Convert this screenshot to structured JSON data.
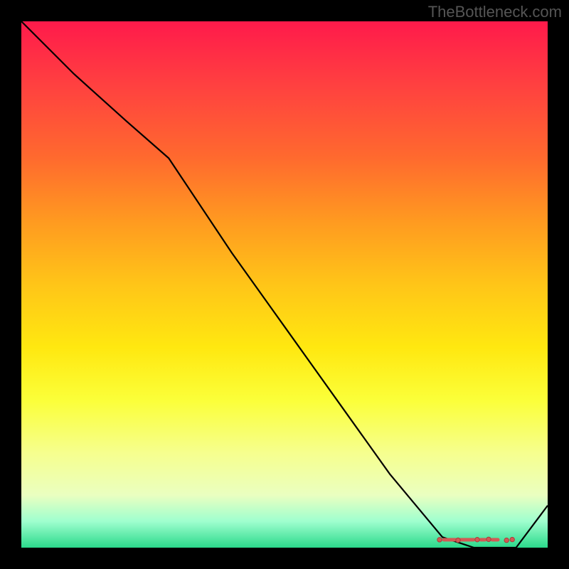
{
  "watermark": "TheBottleneck.com",
  "chart_data": {
    "type": "line",
    "title": "",
    "xlabel": "",
    "ylabel": "",
    "xlim": [
      0,
      100
    ],
    "ylim": [
      0,
      100
    ],
    "series": [
      {
        "name": "curve",
        "x": [
          0,
          10,
          20,
          28,
          40,
          50,
          60,
          70,
          80,
          86,
          90,
          94,
          100
        ],
        "y": [
          100,
          90,
          81,
          74,
          56,
          42,
          28,
          14,
          2,
          0,
          0,
          0,
          8
        ]
      }
    ],
    "markers": {
      "name": "highlight-band",
      "x_range": [
        80,
        93
      ],
      "y": 1.5
    },
    "grid": false,
    "legend": false
  }
}
